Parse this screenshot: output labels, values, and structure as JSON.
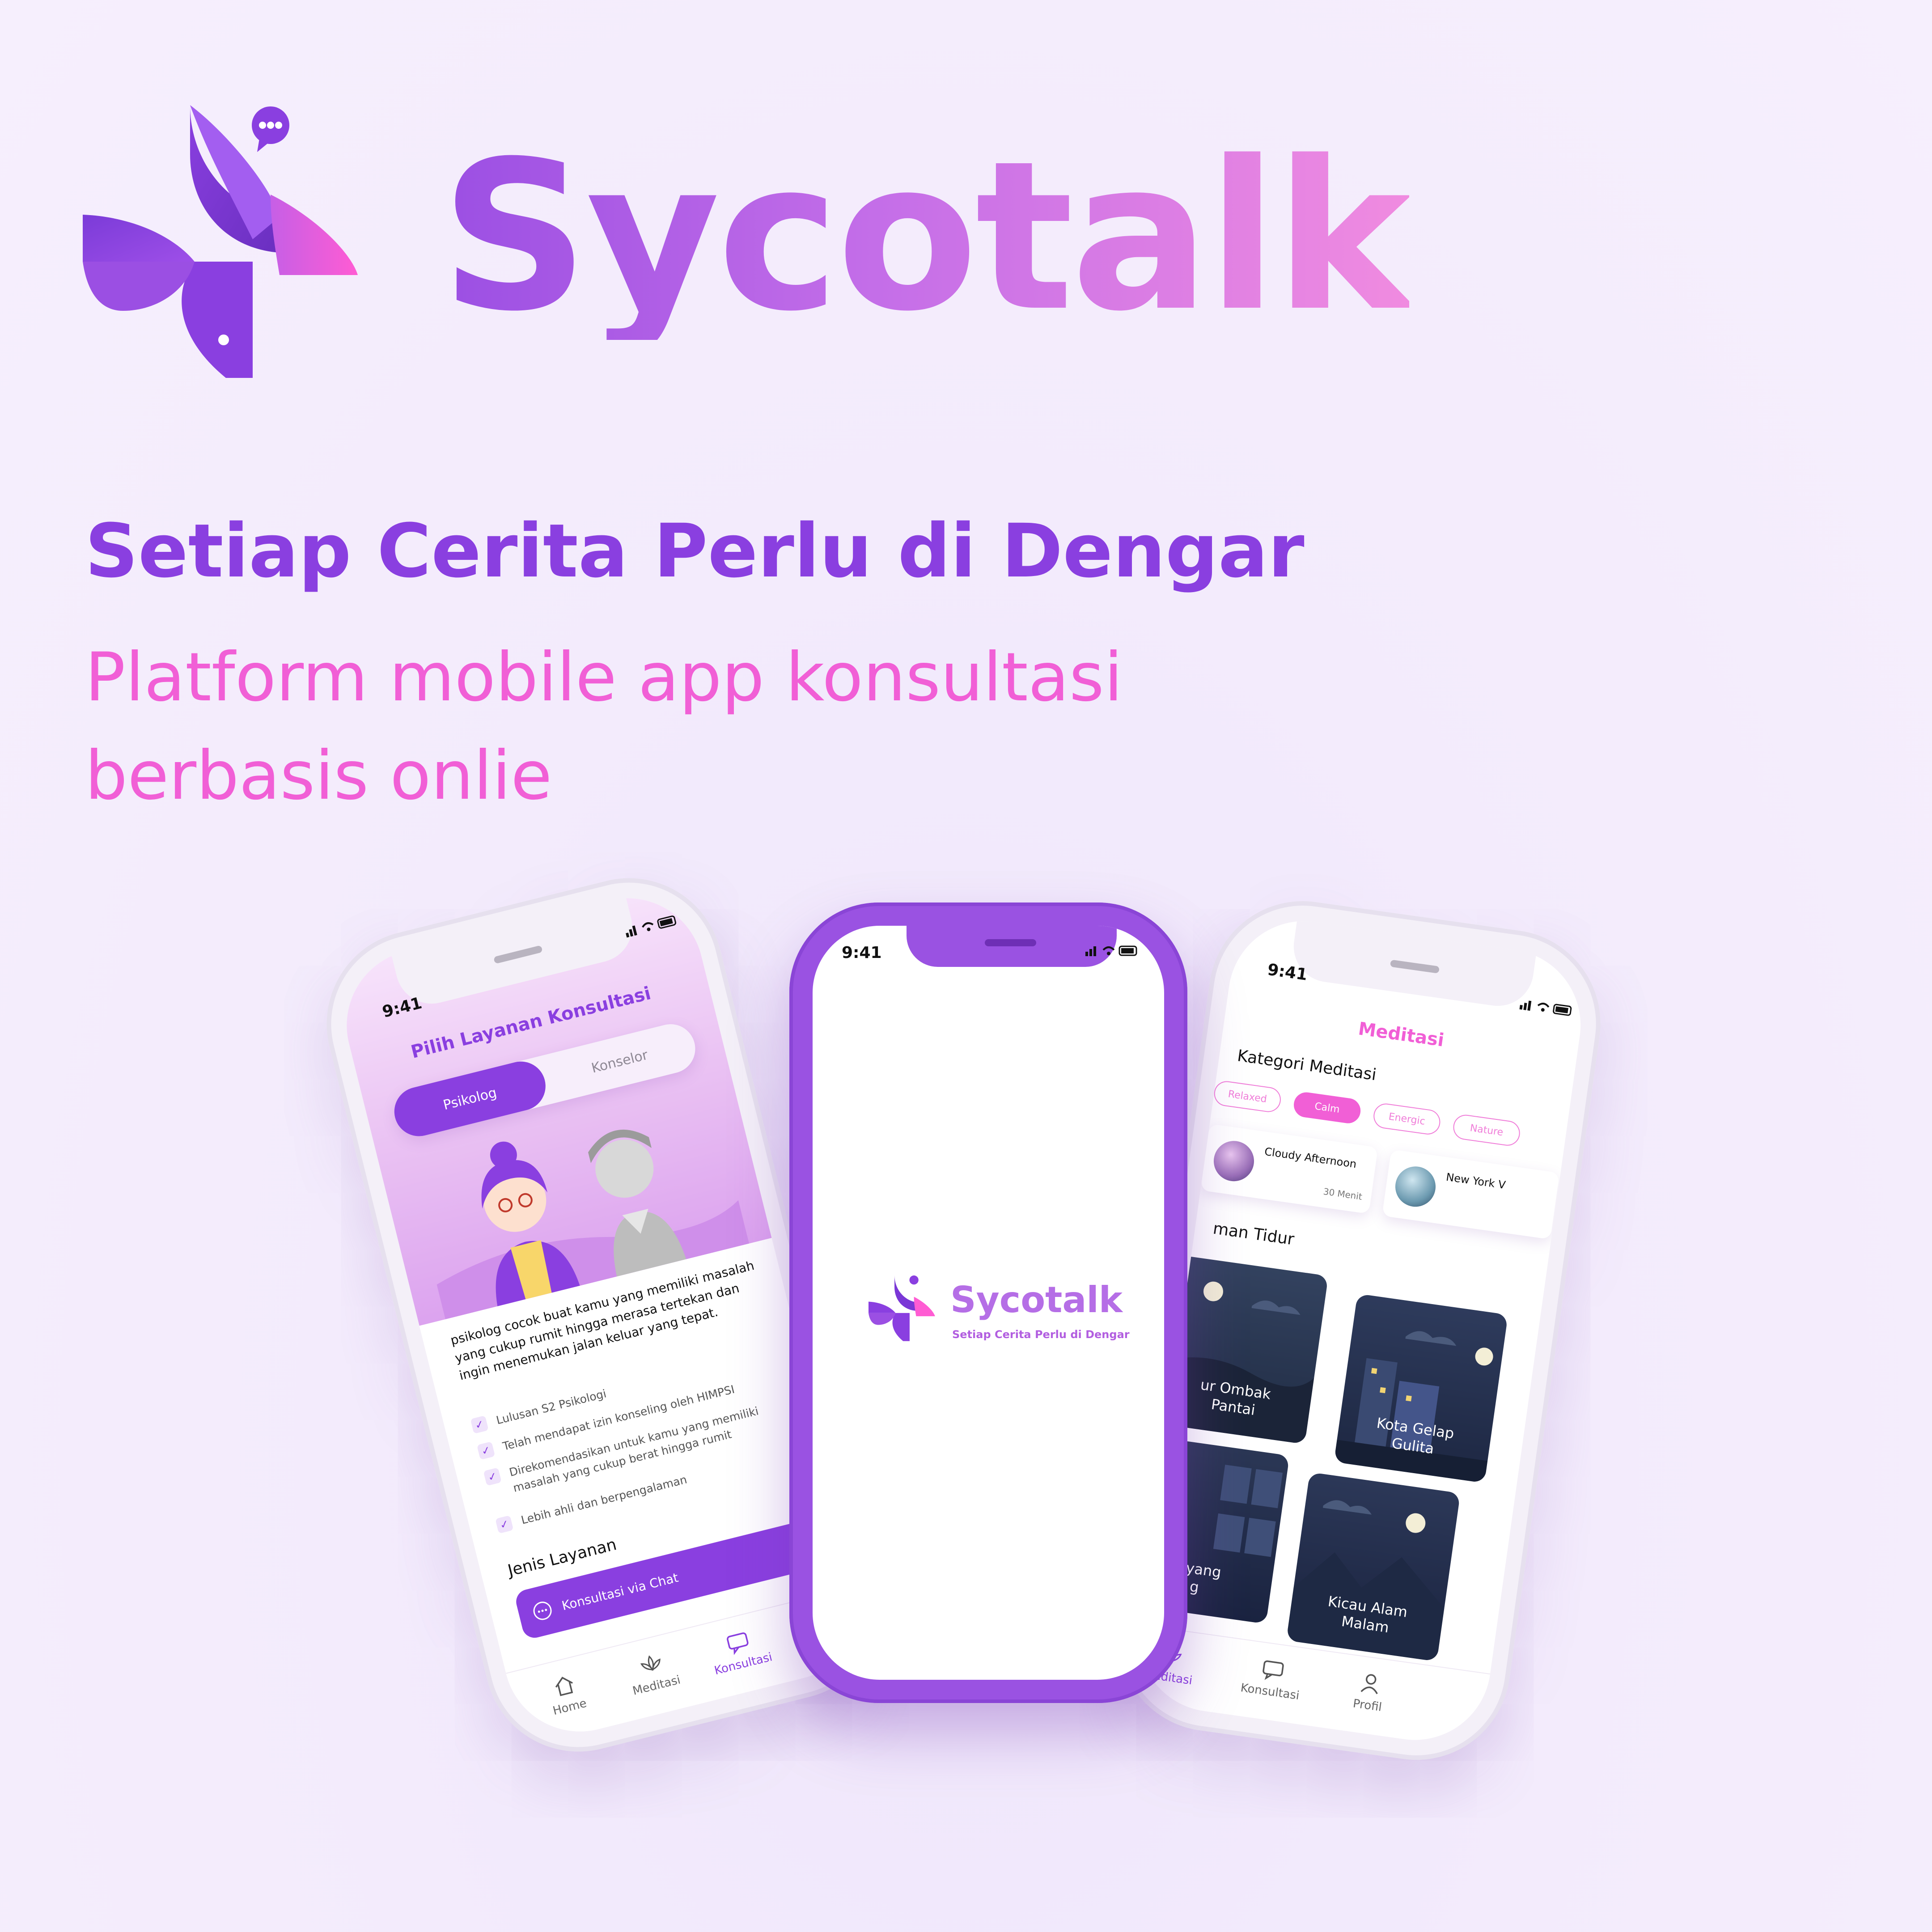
{
  "brand": {
    "name": "Sycotalk",
    "tagline": "Setiap Cerita Perlu di Dengar",
    "subtitle_line1": "Platform mobile app konsultasi",
    "subtitle_line2": "berbasis onlie"
  },
  "colors": {
    "primary_purple": "#8a3fe0",
    "accent_pink": "#f15fd6",
    "background": "#f5eefc",
    "phone_center_frame": "#9a52e2"
  },
  "status_bar": {
    "time": "9:41"
  },
  "left_phone": {
    "title": "Pilih Layanan Konsultasi",
    "tabs": [
      {
        "label": "Psikolog",
        "selected": true
      },
      {
        "label": "Konselor",
        "selected": false
      }
    ],
    "description": "psikolog cocok buat kamu yang memiliki masalah yang cukup rumit hingga merasa tertekan dan ingin menemukan jalan keluar yang tepat.",
    "checklist": [
      "Lulusan S2 Psikologi",
      "Telah mendapat izin konseling oleh HIMPSI",
      "Direkomendasikan untuk kamu yang memiliki",
      "masalah yang cukup berat hingga rumit",
      "Lebih ahli dan berpengalaman"
    ],
    "section_title": "Jenis Layanan",
    "service_button": "Konsultasi via Chat",
    "nav": [
      {
        "label": "Home",
        "icon": "home-icon"
      },
      {
        "label": "Meditasi",
        "icon": "lotus-icon"
      },
      {
        "label": "Konsultasi",
        "icon": "chat-icon"
      }
    ]
  },
  "center_phone": {
    "wordmark": "Sycotalk",
    "tagline": "Setiap Cerita Perlu di Dengar"
  },
  "right_phone": {
    "title": "Meditasi",
    "category_title": "Kategori Meditasi",
    "chips": [
      {
        "label": "Relaxed",
        "active": false
      },
      {
        "label": "Calm",
        "active": true
      },
      {
        "label": "Energic",
        "active": false
      },
      {
        "label": "Nature",
        "active": false
      }
    ],
    "tracks": [
      {
        "name": "Cloudy Afternoon",
        "duration": "30 Menit"
      },
      {
        "name": "New York V",
        "duration": ""
      }
    ],
    "sleep_title": "man Tidur",
    "scenes": [
      {
        "line1": "ur Ombak",
        "line2": "Pantai"
      },
      {
        "line1": "Kota Gelap",
        "line2": "Gulita"
      },
      {
        "line1": "n yang",
        "line2": "g"
      },
      {
        "line1": "Kicau Alam",
        "line2": "Malam"
      }
    ],
    "nav": [
      {
        "label": "Meditasi",
        "icon": "lotus-icon",
        "active": true
      },
      {
        "label": "Konsultasi",
        "icon": "chat-icon",
        "active": false
      },
      {
        "label": "Profil",
        "icon": "profile-icon",
        "active": false
      }
    ]
  }
}
